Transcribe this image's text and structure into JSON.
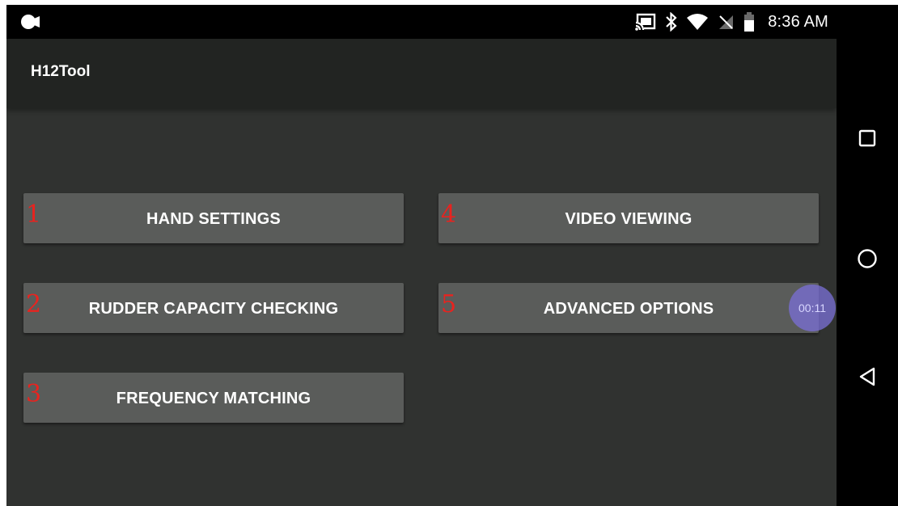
{
  "status_bar": {
    "time": "8:36 AM",
    "icons": [
      "record-icon",
      "cast-icon",
      "bluetooth-icon",
      "wifi-icon",
      "no-signal-icon",
      "battery-icon"
    ]
  },
  "app_bar": {
    "title": "H12Tool"
  },
  "menu": {
    "buttons": [
      {
        "number": "1",
        "label": "HAND SETTINGS"
      },
      {
        "number": "2",
        "label": "RUDDER CAPACITY CHECKING"
      },
      {
        "number": "3",
        "label": "FREQUENCY MATCHING"
      },
      {
        "number": "4",
        "label": "VIDEO VIEWING"
      },
      {
        "number": "5",
        "label": "ADVANCED OPTIONS"
      }
    ]
  },
  "recording_timer": "00:11",
  "nav_bar": {
    "icons": [
      "recents-square-icon",
      "home-circle-icon",
      "back-triangle-icon"
    ]
  },
  "colors": {
    "background": "#303230",
    "app_bar": "#222422",
    "button": "#5a5c5a",
    "number_accent": "#e8231f",
    "timer_bubble": "#786ed2"
  }
}
